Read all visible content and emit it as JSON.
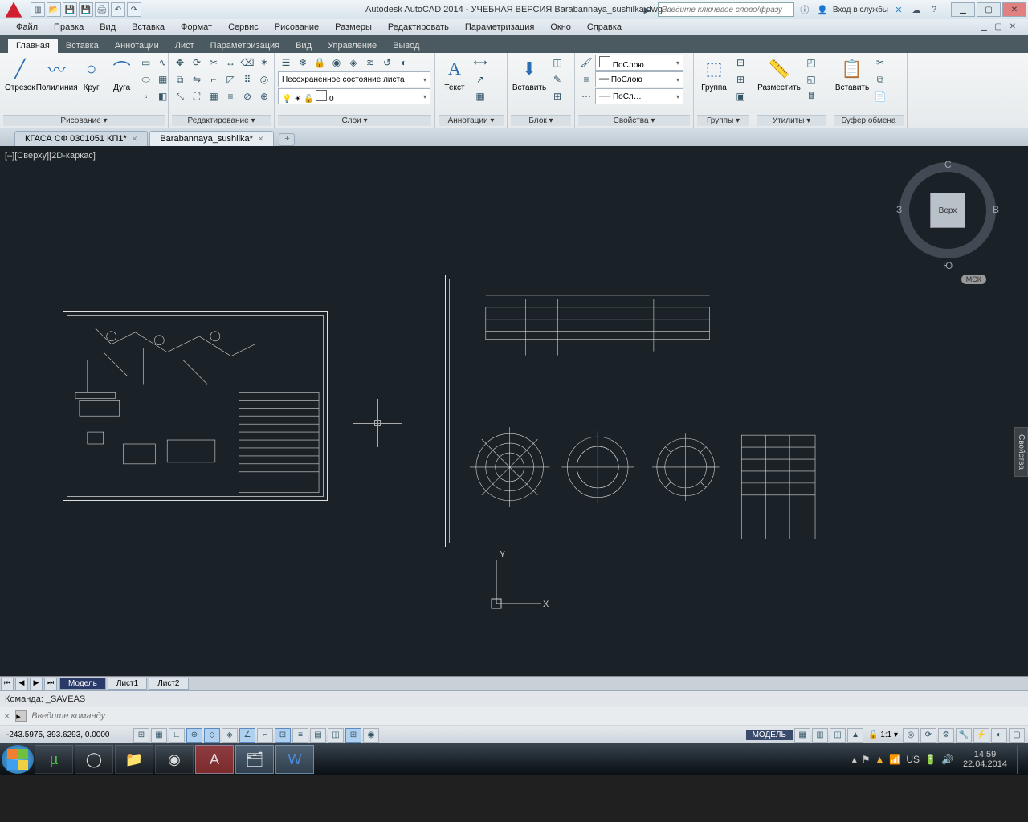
{
  "title": "Autodesk AutoCAD 2014 - УЧЕБНАЯ ВЕРСИЯ   Barabannaya_sushilka.dwg",
  "search_placeholder": "Введите ключевое слово/фразу",
  "login_label": "Вход в службы",
  "menu": [
    "Файл",
    "Правка",
    "Вид",
    "Вставка",
    "Формат",
    "Сервис",
    "Рисование",
    "Размеры",
    "Редактировать",
    "Параметризация",
    "Окно",
    "Справка"
  ],
  "ribbon_tabs": [
    "Главная",
    "Вставка",
    "Аннотации",
    "Лист",
    "Параметризация",
    "Вид",
    "Управление",
    "Вывод"
  ],
  "ribbon": {
    "draw": {
      "title": "Рисование ▾",
      "line": "Отрезок",
      "polyline": "Полилиния",
      "circle": "Круг",
      "arc": "Дуга"
    },
    "modify": {
      "title": "Редактирование ▾"
    },
    "layers": {
      "title": "Слои ▾",
      "state": "Несохраненное состояние листа",
      "layer0": "0"
    },
    "annot": {
      "title": "Аннотации ▾",
      "text": "Текст"
    },
    "block": {
      "title": "Блок ▾",
      "insert": "Вставить"
    },
    "props": {
      "title": "Свойства ▾",
      "bylayer": "ПоСлою",
      "bylayer2": "ПоСлою",
      "bylayer3": "ПоСл…"
    },
    "groups": {
      "title": "Группы ▾",
      "group": "Группа"
    },
    "utils": {
      "title": "Утилиты ▾",
      "measure": "Разместить"
    },
    "clip": {
      "title": "Буфер обмена",
      "paste": "Вставить"
    }
  },
  "file_tabs": [
    {
      "name": "КГАСА СФ 0301051 КП1*",
      "active": false
    },
    {
      "name": "Barabannaya_sushilka*",
      "active": true
    }
  ],
  "view_label": "[–][Сверху][2D-каркас]",
  "viewcube": {
    "face": "Верх",
    "N": "С",
    "S": "Ю",
    "W": "З",
    "E": "В",
    "wcs": "МСК"
  },
  "ucs": {
    "x": "X",
    "y": "Y"
  },
  "side_panel": "Свойства",
  "layout_tabs": {
    "nav": [
      "⏮",
      "◀",
      "▶",
      "⏭"
    ],
    "tabs": [
      "Модель",
      "Лист1",
      "Лист2"
    ],
    "active": 0
  },
  "command": {
    "history": "Команда: _SAVEAS",
    "placeholder": "Введите команду"
  },
  "status": {
    "coords": "-243.5975, 393.6293, 0.0000",
    "model": "МОДЕЛЬ",
    "scale": "1:1"
  },
  "tray": {
    "lang": "US",
    "time": "14:59",
    "date": "22.04.2014"
  }
}
